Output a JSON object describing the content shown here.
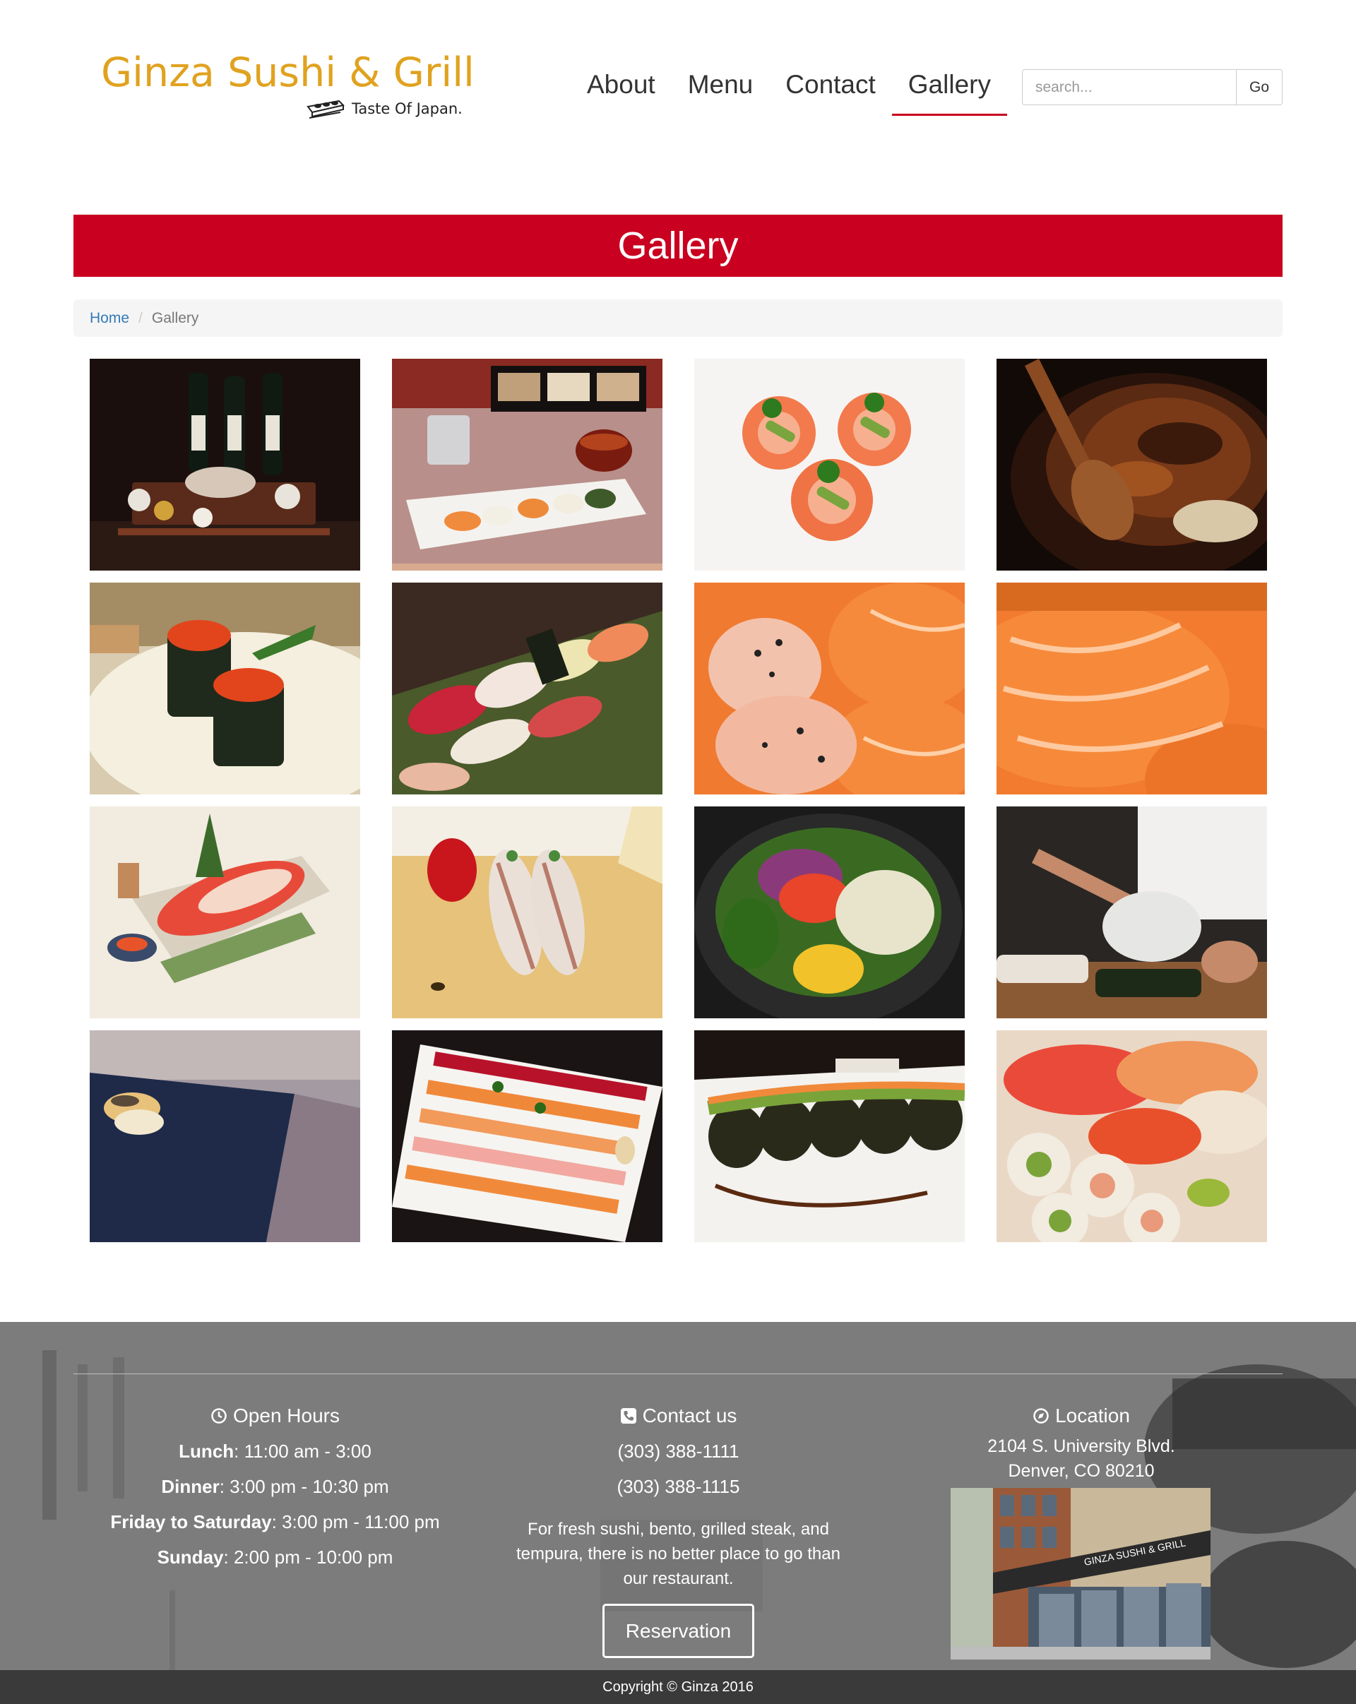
{
  "brand": {
    "name": "Ginza Sushi & Grill",
    "tagline": "Taste Of Japan.",
    "color": "#e0a21f"
  },
  "nav": {
    "items": [
      {
        "label": "About",
        "active": false
      },
      {
        "label": "Menu",
        "active": false
      },
      {
        "label": "Contact",
        "active": false
      },
      {
        "label": "Gallery",
        "active": true
      }
    ]
  },
  "search": {
    "placeholder": "search...",
    "value": "",
    "button_label": "Go"
  },
  "page": {
    "title": "Gallery",
    "accent_color": "#c9001f"
  },
  "breadcrumb": {
    "home": "Home",
    "separator": "/",
    "current": "Gallery"
  },
  "gallery": {
    "images": [
      "sake-bottles-and-sashimi",
      "bento-box-sushi-plate",
      "shrimp-appetizers",
      "unagi-don-bowl",
      "tobiko-gunkan",
      "assorted-nigiri",
      "spicy-salmon-rolls",
      "salmon-nigiri-closeup",
      "sashimi-boat",
      "mackerel-nigiri",
      "poke-salad-bowl",
      "chef-rolling-sushi",
      "roll-on-slate",
      "nigiri-platter",
      "dragon-roll",
      "sashimi-and-california-roll"
    ]
  },
  "footer": {
    "hours": {
      "heading": "Open Hours",
      "lines": [
        {
          "label": "Lunch",
          "value": ": 11:00 am - 3:00"
        },
        {
          "label": "Dinner",
          "value": ": 3:00 pm - 10:30 pm"
        },
        {
          "label": "Friday to Saturday",
          "value": ": 3:00 pm - 11:00 pm"
        },
        {
          "label": "Sunday",
          "value": ": 2:00 pm - 10:00 pm"
        }
      ]
    },
    "contact": {
      "heading": "Contact us",
      "phones": [
        "(303) 388-1111",
        "(303) 388-1115"
      ],
      "blurb": "For fresh sushi, bento, grilled steak, and tempura, there is no better place to go than our restaurant.",
      "button_label": "Reservation"
    },
    "location": {
      "heading": "Location",
      "address_line1": "2104 S. University Blvd.",
      "address_line2": "Denver, CO 80210",
      "sign_text": "GINZA SUSHI & GRILL"
    },
    "copyright": "Copyright © Ginza 2016"
  }
}
